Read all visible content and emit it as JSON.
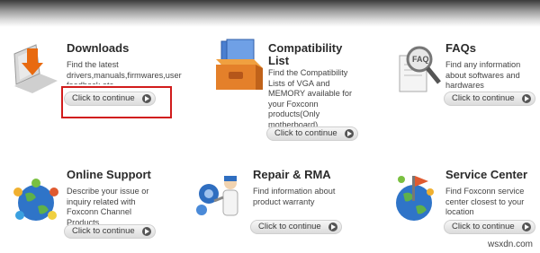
{
  "cards": [
    {
      "title": "Downloads",
      "description": "Find the latest drivers,manuals,firmwares,user feedback,etc",
      "button": "Click to continue"
    },
    {
      "title": "Compatibility List",
      "description": "Find the Compatibility Lists of VGA and MEMORY available for your Foxconn products(Only motherboard)",
      "button": "Click to continue"
    },
    {
      "title": "FAQs",
      "description": "Find any information about softwares and hardwares",
      "button": "Click to continue"
    },
    {
      "title": "Online Support",
      "description": "Describe your issue or inquiry related with Foxconn Channel Products",
      "button": "Click to continue"
    },
    {
      "title": "Repair & RMA",
      "description": "Find information about product warranty",
      "button": "Click to continue"
    },
    {
      "title": "Service Center",
      "description": "Find Foxconn service center closest to your location",
      "button": "Click to continue"
    }
  ],
  "watermark": "wsxdn.com",
  "colors": {
    "highlight": "#d11c1c",
    "title": "#2b2b2b"
  }
}
